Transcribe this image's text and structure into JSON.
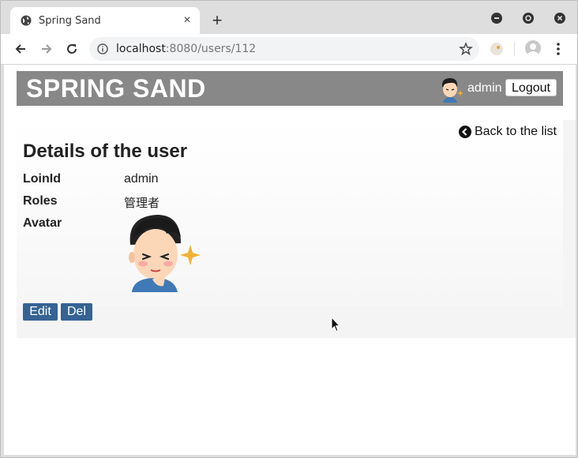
{
  "browser": {
    "tab_title": "Spring Sand",
    "url_host": "localhost",
    "url_rest": ":8080/users/112"
  },
  "navbar": {
    "brand": "SPRING SAND",
    "username": "admin",
    "logout_label": "Logout"
  },
  "details": {
    "back_label": "Back to the list",
    "heading": "Details of the user",
    "fields": [
      {
        "label": "LoinId",
        "value": "admin"
      },
      {
        "label": "Roles",
        "value": "管理者"
      },
      {
        "label": "Avatar",
        "value": ""
      }
    ],
    "edit_label": "Edit",
    "delete_label": "Del"
  },
  "colors": {
    "navbar_bg": "#888888",
    "button_bg": "#356394"
  }
}
